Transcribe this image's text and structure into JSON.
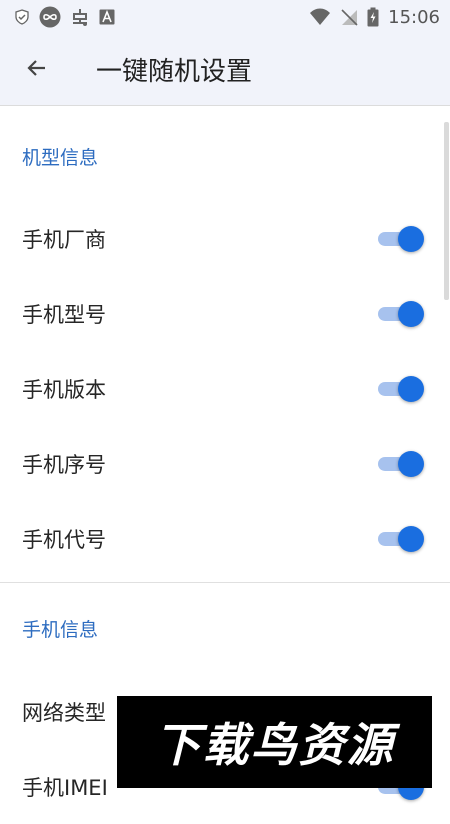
{
  "status_bar": {
    "time": "15:06",
    "left_icons": [
      "shield-check-icon",
      "infinity-icon",
      "bug-icon",
      "font-a-icon"
    ],
    "right_icons": [
      "wifi-icon",
      "no-signal-icon",
      "battery-charging-icon"
    ]
  },
  "app_bar": {
    "title": "一键随机设置",
    "back_icon": "arrow-left-icon"
  },
  "sections": [
    {
      "header": "机型信息",
      "items": [
        {
          "label": "手机厂商",
          "checked": true
        },
        {
          "label": "手机型号",
          "checked": true
        },
        {
          "label": "手机版本",
          "checked": true
        },
        {
          "label": "手机序号",
          "checked": true
        },
        {
          "label": "手机代号",
          "checked": true
        }
      ]
    },
    {
      "header": "手机信息",
      "items": [
        {
          "label": "网络类型",
          "checked": true
        },
        {
          "label": "手机IMEI",
          "checked": true
        }
      ]
    }
  ],
  "watermark": {
    "text": "下载鸟资源"
  },
  "colors": {
    "accent": "#1a6ee0",
    "track": "#a7c2ee",
    "section_header": "#2d6cc0",
    "app_bar_bg": "#f1f3fa"
  }
}
